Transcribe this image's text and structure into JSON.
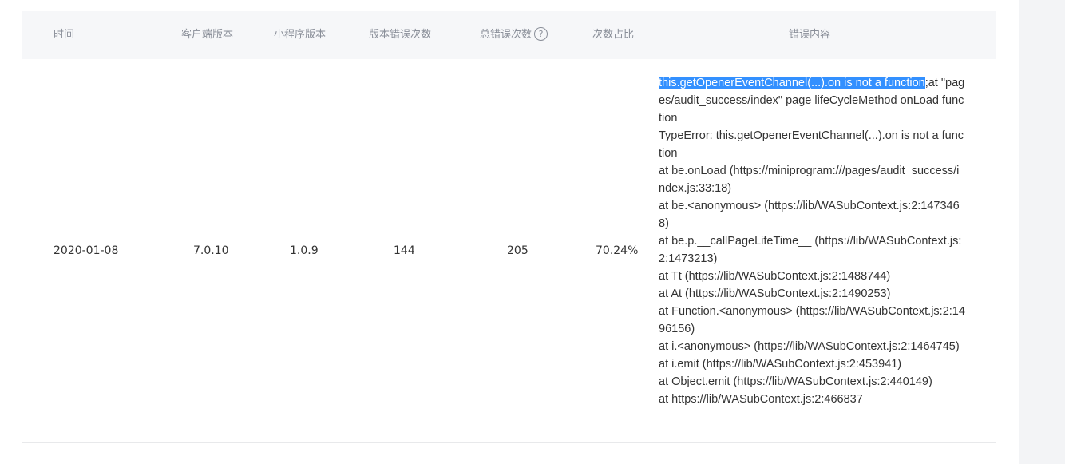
{
  "table": {
    "headers": {
      "time": "时间",
      "client_version": "客户端版本",
      "mini_version": "小程序版本",
      "version_error_count": "版本错误次数",
      "total_error_count": "总错误次数",
      "ratio": "次数占比",
      "error_content": "错误内容"
    },
    "rows": [
      {
        "time": "2020-01-08",
        "client_version": "7.0.10",
        "mini_version": "1.0.9",
        "version_error_count": "144",
        "total_error_count": "205",
        "ratio": "70.24%",
        "error": {
          "selected": "this.getOpenerEventChannel(...).on is not a function",
          "first_rest": ";at \"pages/audit_success/index\" page lifeCycleMethod onLoad function",
          "lines": [
            "TypeError: this.getOpenerEventChannel(...).on is not a function",
            "at be.onLoad (https://miniprogram:///pages/audit_success/index.js:33:18)",
            "at be.<anonymous> (https://lib/WASubContext.js:2:1473468)",
            "at be.p.__callPageLifeTime__ (https://lib/WASubContext.js:2:1473213)",
            "at Tt (https://lib/WASubContext.js:2:1488744)",
            "at At (https://lib/WASubContext.js:2:1490253)",
            "at Function.<anonymous> (https://lib/WASubContext.js:2:1496156)",
            "at i.<anonymous> (https://lib/WASubContext.js:2:1464745)",
            "at i.emit (https://lib/WASubContext.js:2:453941)",
            "at Object.emit (https://lib/WASubContext.js:2:440149)",
            "at https://lib/WASubContext.js:2:466837"
          ]
        }
      }
    ]
  }
}
